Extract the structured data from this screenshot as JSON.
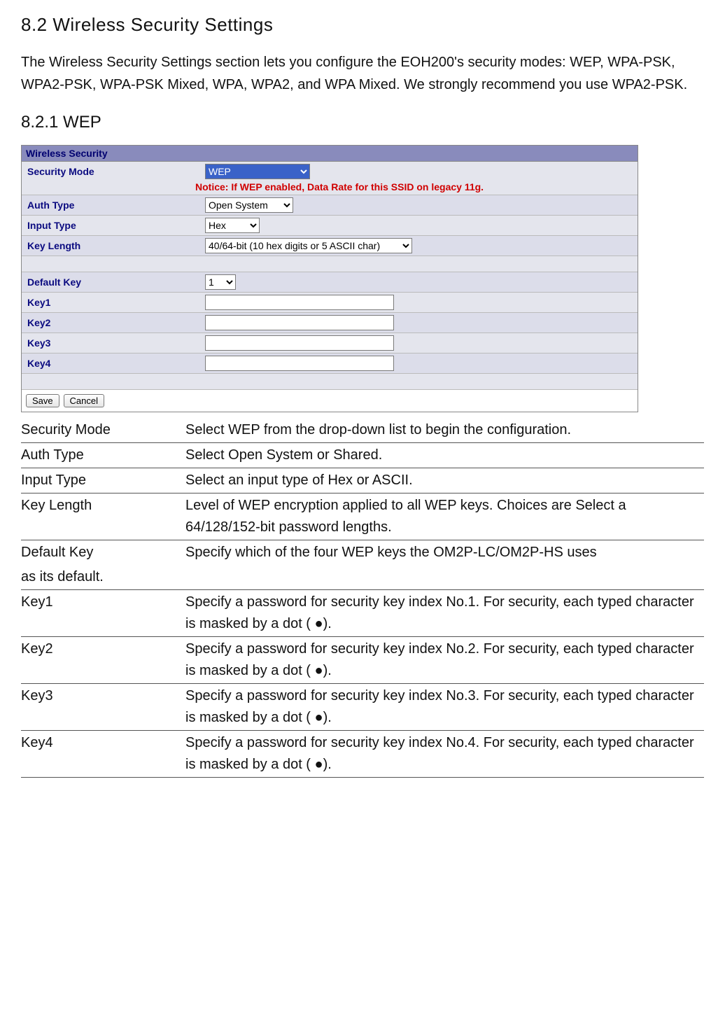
{
  "section_heading": "8.2  Wireless  Security  Settings",
  "intro_paragraph": "The Wireless Security Settings section lets you configure the EOH200's security modes: WEP, WPA-PSK, WPA2-PSK, WPA-PSK Mixed, WPA, WPA2, and WPA Mixed. We strongly recommend you use WPA2-PSK.",
  "subsection_heading": "8.2.1  WEP",
  "ui": {
    "panel_title": "Wireless Security",
    "rows": {
      "security_mode": {
        "label": "Security Mode",
        "value": "WEP"
      },
      "notice": "Notice: If WEP enabled, Data Rate for this SSID on legacy 11g.",
      "auth_type": {
        "label": "Auth Type",
        "value": "Open System"
      },
      "input_type": {
        "label": "Input Type",
        "value": "Hex"
      },
      "key_length": {
        "label": "Key Length",
        "value": "40/64-bit (10 hex digits or 5 ASCII char)"
      },
      "default_key": {
        "label": "Default Key",
        "value": "1"
      },
      "key1": {
        "label": "Key1",
        "value": ""
      },
      "key2": {
        "label": "Key2",
        "value": ""
      },
      "key3": {
        "label": "Key3",
        "value": ""
      },
      "key4": {
        "label": "Key4",
        "value": ""
      }
    },
    "buttons": {
      "save": "Save",
      "cancel": "Cancel"
    }
  },
  "descriptions": {
    "security_mode": {
      "term": "Security  Mode",
      "def": "Select WEP  from the drop-down list to begin the configuration."
    },
    "auth_type": {
      "term": "Auth  Type",
      "def": "Select Open System  or Shared."
    },
    "input_type": {
      "term": "Input  Type",
      "def": "Select an input type of Hex  or ASCII."
    },
    "key_length": {
      "term": "Key  Length",
      "def": "Level of WEP encryption applied to all WEP keys. Choices are Select a 64/128/152-bit password lengths."
    },
    "default_key": {
      "term": "Default  Key",
      "def": "Specify which of the four WEP keys the OM2P-LC/OM2P-HS uses"
    },
    "default_key_cont": "as its default.",
    "key1": {
      "term": "Key1",
      "def": "Specify a password for security key index No.1. For security, each typed character is masked by a dot (     ●)."
    },
    "key2": {
      "term": "Key2",
      "def": "Specify a password for security key index No.2. For security, each typed character is masked by a dot (     ●)."
    },
    "key3": {
      "term": "Key3",
      "def": "Specify a password for security key index No.3. For security, each typed character is masked by a dot (     ●)."
    },
    "key4": {
      "term": "Key4",
      "def": "Specify a password for security key index No.4. For security, each typed character is masked by a dot (     ●)."
    }
  }
}
